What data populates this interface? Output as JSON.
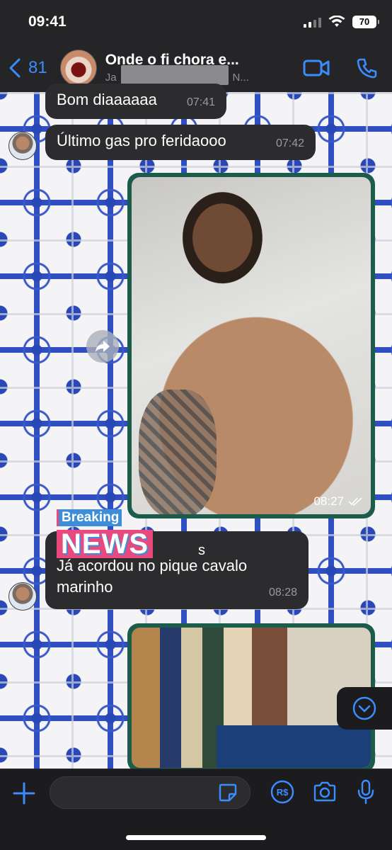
{
  "status_bar": {
    "time": "09:41",
    "battery": "70"
  },
  "header": {
    "back_count": "81",
    "title": "Onde o fi chora e...",
    "subtitle_start": "Ja",
    "subtitle_end": "N..."
  },
  "messages": [
    {
      "text": "Bom diaaaaaa",
      "time": "07:41"
    },
    {
      "text": "Último gas pro feridaooo",
      "time": "07:42"
    },
    {
      "type": "image",
      "time": "08:27",
      "status": "read"
    },
    {
      "breaking_label": "Breaking",
      "news_label": "NEWS",
      "news_suffix": "s",
      "line1": "Já acordou no pique cavalo",
      "line2": "marinho",
      "time": "08:28"
    },
    {
      "type": "image"
    }
  ],
  "input": {
    "placeholder": ""
  },
  "colors": {
    "accent": "#3a8dff",
    "bubble": "#2c2c2e",
    "media_border": "#1d5b4a",
    "bar": "#1c1c1e"
  }
}
